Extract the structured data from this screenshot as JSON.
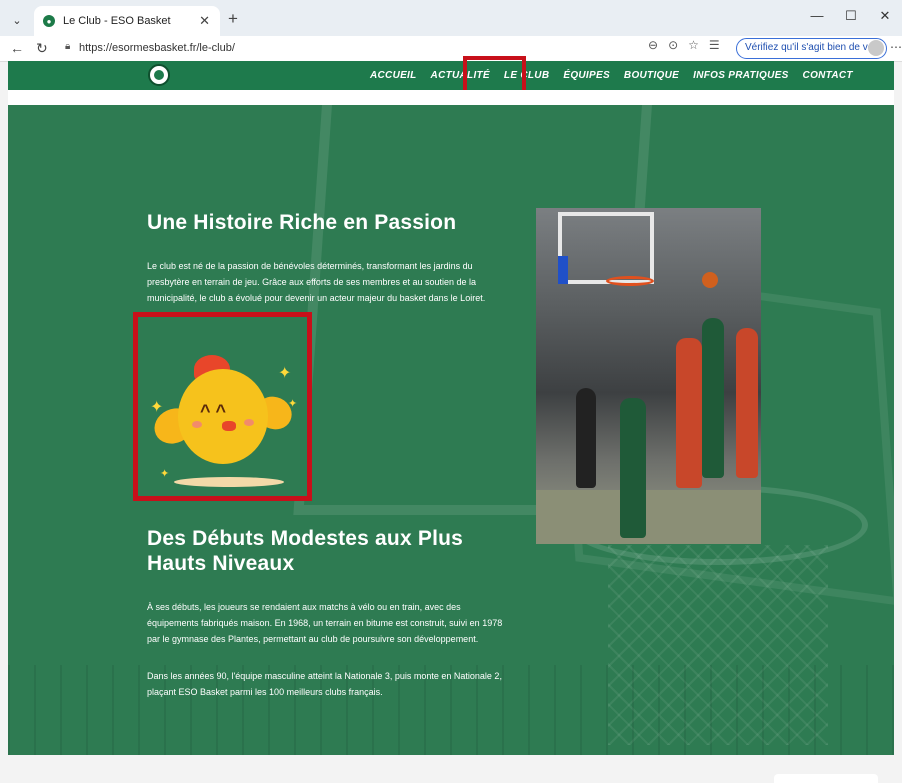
{
  "browser": {
    "tab_title": "Le Club - ESO Basket",
    "url": "https://esormesbasket.fr/le-club/",
    "verify_label": "Vérifiez qu'il s'agit bien de vous"
  },
  "nav": {
    "items": [
      "ACCUEIL",
      "ACTUALITÉ",
      "LE CLUB",
      "ÉQUIPES",
      "BOUTIQUE",
      "INFOS PRATIQUES",
      "CONTACT"
    ],
    "active": "LE CLUB"
  },
  "section1": {
    "title": "Une Histoire Riche en Passion",
    "body": "Le club est né de la passion de bénévoles déterminés, transformant les jardins du presbytère en terrain de jeu. Grâce aux efforts de ses membres et au soutien de la municipalité, le club a évolué pour devenir un acteur majeur du basket dans le Loiret."
  },
  "section2": {
    "title": "Des Débuts Modestes aux Plus Hauts Niveaux",
    "body1": "À ses débuts, les joueurs se rendaient aux matchs à vélo ou en train, avec des équipements fabriqués maison. En 1968, un terrain en bitume est construit, suivi en 1978 par le gymnase des Plantes, permettant au club de poursuivre son développement.",
    "body2": "Dans les années 90, l'équipe masculine atteint la Nationale 3, puis monte en Nationale 2, plaçant ESO Basket parmi les 100 meilleurs clubs français."
  },
  "colors": {
    "brand_green": "#1e7a4c",
    "hero_green": "#2e7b52",
    "highlight_red": "#c8101a"
  },
  "icons": [
    "tab-menu-icon",
    "favicon-icon",
    "close-icon",
    "new-tab-icon",
    "back-icon",
    "refresh-icon",
    "lock-icon",
    "zoom-icon",
    "star-icon",
    "favorites-icon",
    "profile-icon",
    "more-icon",
    "club-logo-icon"
  ]
}
